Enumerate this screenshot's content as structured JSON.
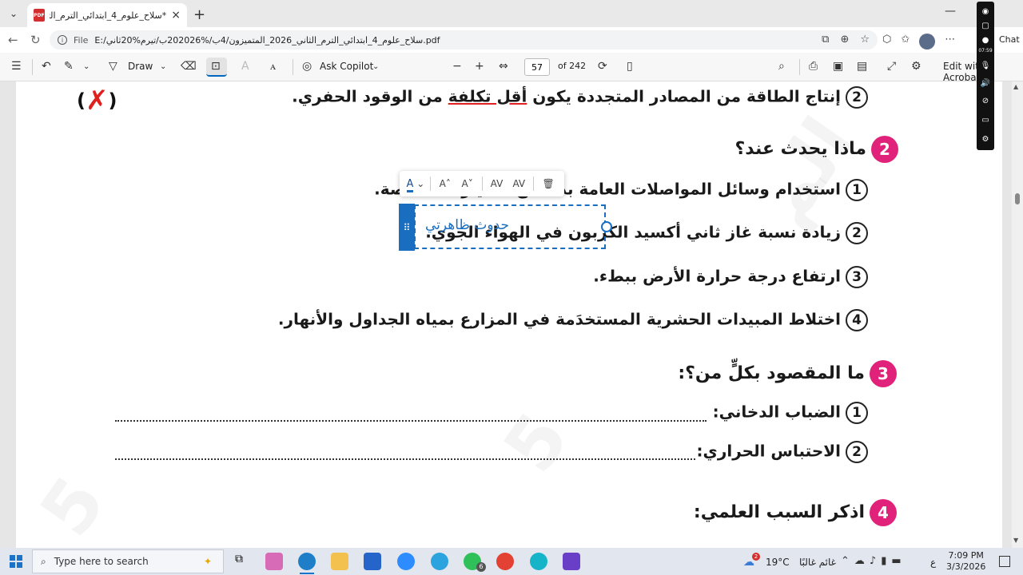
{
  "browser": {
    "tab_title": "*سلاح_علوم_4_ابتدائي_الترم_الثاني_6...",
    "file_label": "File",
    "url": "E:/سلاح_علوم_4_ابتدائي_الترم_الثاني_2026_المتميزون/4ب/%202026ب/تيرم%20ثاني.pdf"
  },
  "pdf_toolbar": {
    "draw_label": "Draw",
    "copilot_label": "Ask Copilot",
    "page_current": "57",
    "page_total": "of 242",
    "edit_label": "Edit with Acrobat",
    "chat_label": "Chat"
  },
  "document": {
    "q_prev_item2_num": "2",
    "q_prev_item2_a": "إنتاج الطاقة من المصادر المتجددة يكون ",
    "q_prev_item2_b": "أقل تكلفة",
    "q_prev_item2_c": " من الوقود الحفري.",
    "answer_open": "(",
    "answer_mark": "✗",
    "answer_close": ")",
    "section2_num": "2",
    "section2_title": "ماذا يحدث عند؟",
    "s2_items": [
      {
        "num": "1",
        "text": "استخدام وسائل المواصلات العامة بدلًا من السيارات الخاصة."
      },
      {
        "num": "2",
        "text": "زيادة نسبة غاز ثاني أكسيد الكربون في الهواء الجوي."
      },
      {
        "num": "3",
        "text": "ارتفاع درجة حرارة الأرض ببطء."
      },
      {
        "num": "4",
        "text": "اختلاط المبيدات الحشرية المستخدَمة في المزارع بمياه الجداول والأنهار."
      }
    ],
    "section3_num": "3",
    "section3_title": "ما المقصود بكلٍّ من؟:",
    "s3_items": [
      {
        "num": "1",
        "text": "الضباب الدخاني:"
      },
      {
        "num": "2",
        "text": "الاحتباس الحراري:"
      }
    ],
    "section4_num": "4",
    "section4_title": "اذكر السبب العلمي:",
    "annotation_text": "حدوث ظاهرتي"
  },
  "taskbar": {
    "search_placeholder": "Type here to search",
    "weather_temp": "19°C",
    "weather_desc": "غائم غالبًا",
    "weather_badge": "2",
    "lang": "ع",
    "time": "7:09 PM",
    "date": "3/3/2026",
    "whatsapp_badge": "6"
  },
  "side_panel": {
    "timer": "07:59"
  },
  "colors": {
    "accent": "#1a6ec0",
    "section_badge": "#e0227a",
    "error_mark": "#e0201c"
  }
}
